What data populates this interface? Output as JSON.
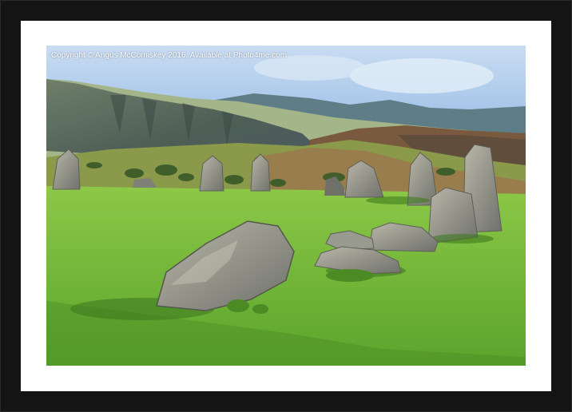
{
  "photo": {
    "copyright_text": "Copyright © Angus McComiskey 2016. Available at Photo4me.com"
  },
  "colors": {
    "frame": "#141414",
    "mount": "#ffffff",
    "sky": "#9fc1e6",
    "grass": "#6fb53a",
    "stone": "#8f9186"
  }
}
